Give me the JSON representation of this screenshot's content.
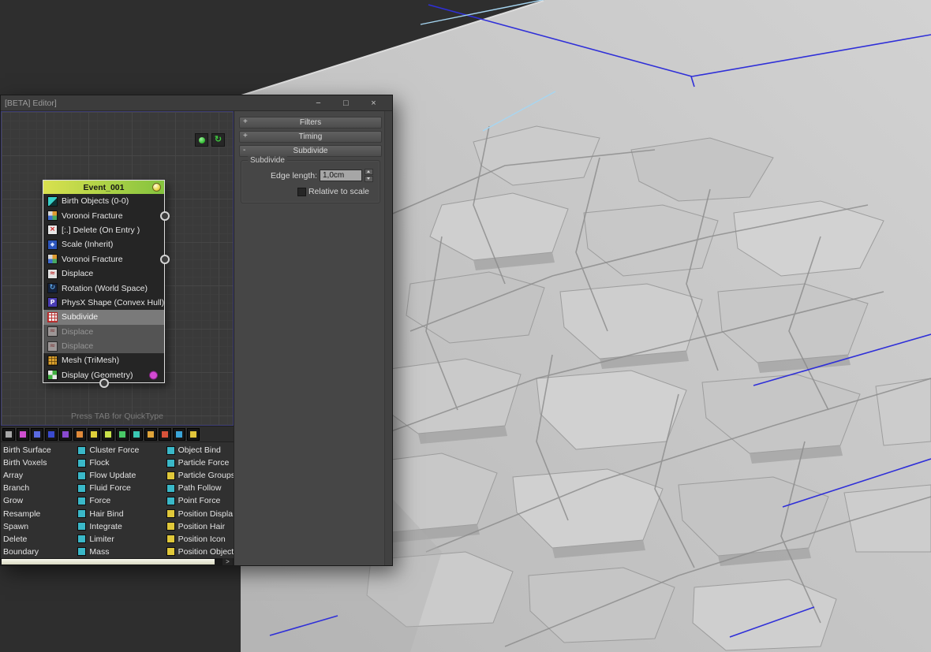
{
  "window": {
    "title": "[BETA] Editor]",
    "controls": {
      "minimize": "−",
      "maximize": "□",
      "close": "×"
    }
  },
  "colors": {
    "selection_wireframe": "#2f2fd8",
    "highlight_line": "#a6d6f2",
    "event_header_start": "#d9e14f",
    "event_header_end": "#84c33e",
    "display_dot": "#d24ad2"
  },
  "node_view": {
    "hint": "Press TAB for QuickType",
    "refresh_glyph": "↻",
    "event": {
      "title": "Event_001",
      "rows": [
        {
          "label": "Birth Objects (0-0)",
          "icon": "birth-objects",
          "state": "normal"
        },
        {
          "label": "Voronoi Fracture",
          "icon": "voronoi",
          "state": "normal",
          "port": true
        },
        {
          "label": "[:.] Delete (On Entry )",
          "icon": "delete",
          "state": "normal"
        },
        {
          "label": "Scale (Inherit)",
          "icon": "scale",
          "state": "normal"
        },
        {
          "label": "Voronoi Fracture",
          "icon": "voronoi",
          "state": "normal",
          "port": true
        },
        {
          "label": "Displace",
          "icon": "displace",
          "state": "normal"
        },
        {
          "label": "Rotation (World Space)",
          "icon": "rotation",
          "state": "normal"
        },
        {
          "label": "PhysX Shape (Convex Hull)",
          "icon": "physx",
          "state": "normal"
        },
        {
          "label": "Subdivide",
          "icon": "subdivide",
          "state": "selected"
        },
        {
          "label": "Displace",
          "icon": "displace-off",
          "state": "disabled"
        },
        {
          "label": "Displace",
          "icon": "displace-off",
          "state": "disabled"
        },
        {
          "label": "Mesh (TriMesh)",
          "icon": "mesh",
          "state": "normal"
        },
        {
          "label": "Display (Geometry)",
          "icon": "display",
          "state": "normal",
          "dot": true
        }
      ]
    }
  },
  "params": {
    "rollouts": [
      {
        "label": "Filters",
        "toggle": "+"
      },
      {
        "label": "Timing",
        "toggle": "+"
      },
      {
        "label": "Subdivide",
        "toggle": "-"
      }
    ],
    "subdivide": {
      "group_label": "Subdivide",
      "edge_length_label": "Edge length:",
      "edge_length_value": "1,0cm",
      "relative_label": "Relative to scale"
    }
  },
  "depot": {
    "more_glyph": ">",
    "toolbar": [
      {
        "name": "all-category-icon",
        "color": "#a8a8a8"
      },
      {
        "name": "birth-category-icon",
        "color": "#cf4fcf"
      },
      {
        "name": "force-category-icon",
        "color": "#5a6ae0"
      },
      {
        "name": "groups-category-icon",
        "color": "#3a4ace"
      },
      {
        "name": "material-category-icon",
        "color": "#8a4ad0"
      },
      {
        "name": "mesh-category-icon",
        "color": "#e08a3a"
      },
      {
        "name": "modify-category-icon",
        "color": "#e0d03a"
      },
      {
        "name": "physx-category-icon",
        "color": "#c8e04a"
      },
      {
        "name": "position-category-icon",
        "color": "#49c868"
      },
      {
        "name": "rotation-category-icon",
        "color": "#3ac8b4"
      },
      {
        "name": "scale-category-icon",
        "color": "#e0a43a"
      },
      {
        "name": "shape-category-icon",
        "color": "#d8523a"
      },
      {
        "name": "spin-category-icon",
        "color": "#3aa4d8"
      },
      {
        "name": "test-category-icon",
        "color": "#e0c43a"
      }
    ],
    "col1": [
      {
        "label": "Birth Surface"
      },
      {
        "label": "Birth Voxels"
      },
      {
        "label": "Array"
      },
      {
        "label": "Branch"
      },
      {
        "label": "Grow"
      },
      {
        "label": "Resample"
      },
      {
        "label": "Spawn"
      },
      {
        "label": "Delete"
      },
      {
        "label": "Boundary"
      }
    ],
    "col2": [
      {
        "label": "Cluster Force",
        "color": "#3ab8c8"
      },
      {
        "label": "Flock",
        "color": "#3ab8c8"
      },
      {
        "label": "Flow Update",
        "color": "#3ab8c8"
      },
      {
        "label": "Fluid Force",
        "color": "#3ab8c8"
      },
      {
        "label": "Force",
        "color": "#3ab8c8"
      },
      {
        "label": "Hair Bind",
        "color": "#3ab8c8"
      },
      {
        "label": "Integrate",
        "color": "#3ab8c8"
      },
      {
        "label": "Limiter",
        "color": "#3ab8c8"
      },
      {
        "label": "Mass",
        "color": "#3ab8c8"
      }
    ],
    "col3": [
      {
        "label": "Object Bind",
        "color": "#3ab8c8"
      },
      {
        "label": "Particle Force",
        "color": "#3ab8c8"
      },
      {
        "label": "Particle Groups",
        "color": "#e0c83a"
      },
      {
        "label": "Path Follow",
        "color": "#3ab8c8"
      },
      {
        "label": "Point Force",
        "color": "#3ab8c8"
      },
      {
        "label": "Position Displa",
        "color": "#e0c83a"
      },
      {
        "label": "Position Hair",
        "color": "#e0c83a"
      },
      {
        "label": "Position Icon",
        "color": "#e0c83a"
      },
      {
        "label": "Position Object",
        "color": "#e0c83a"
      }
    ]
  }
}
